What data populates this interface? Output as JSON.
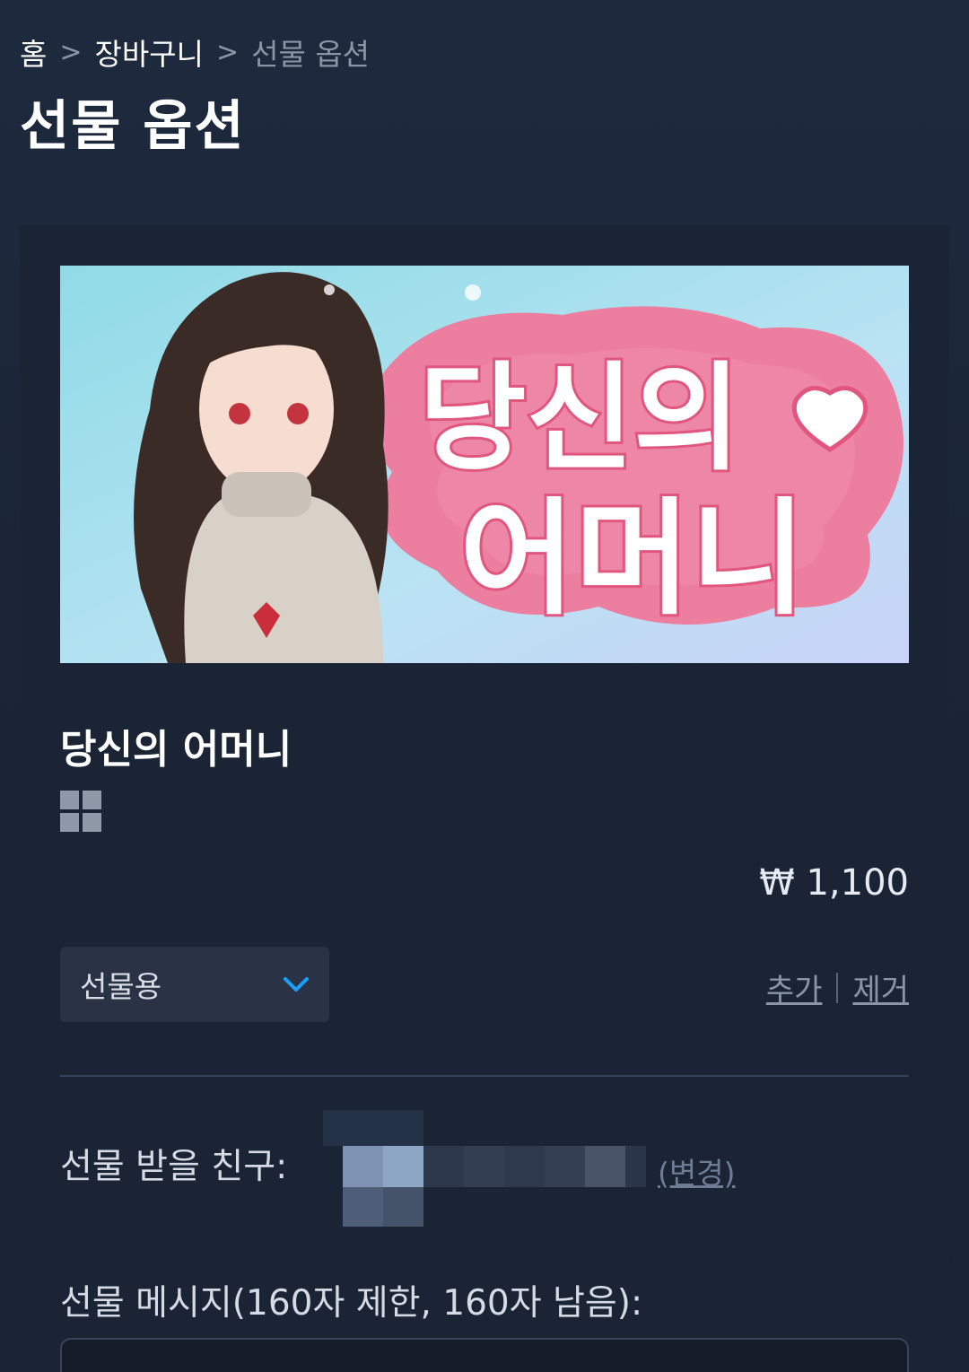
{
  "breadcrumb": {
    "home": "홈",
    "cart": "장바구니",
    "current": "선물 옵션",
    "separator": ">"
  },
  "page": {
    "title": "선물 옵션"
  },
  "item": {
    "banner_text_line1": "당신의",
    "banner_text_line2": "어머니",
    "title": "당신의 어머니",
    "platform_icon": "windows-icon",
    "price": "₩ 1,100",
    "purchase_type": "선물용",
    "add_label": "추가",
    "remove_label": "제거"
  },
  "gift": {
    "recipient_label": "선물 받을 친구:",
    "change_label": "(변경)",
    "message_label": "선물 메시지(160자 제한, 160자 남음):"
  },
  "colors": {
    "background": "#1b2537",
    "card": "#1a2435",
    "accent_blue": "#1a9fff",
    "muted_text": "#8a96a8"
  }
}
